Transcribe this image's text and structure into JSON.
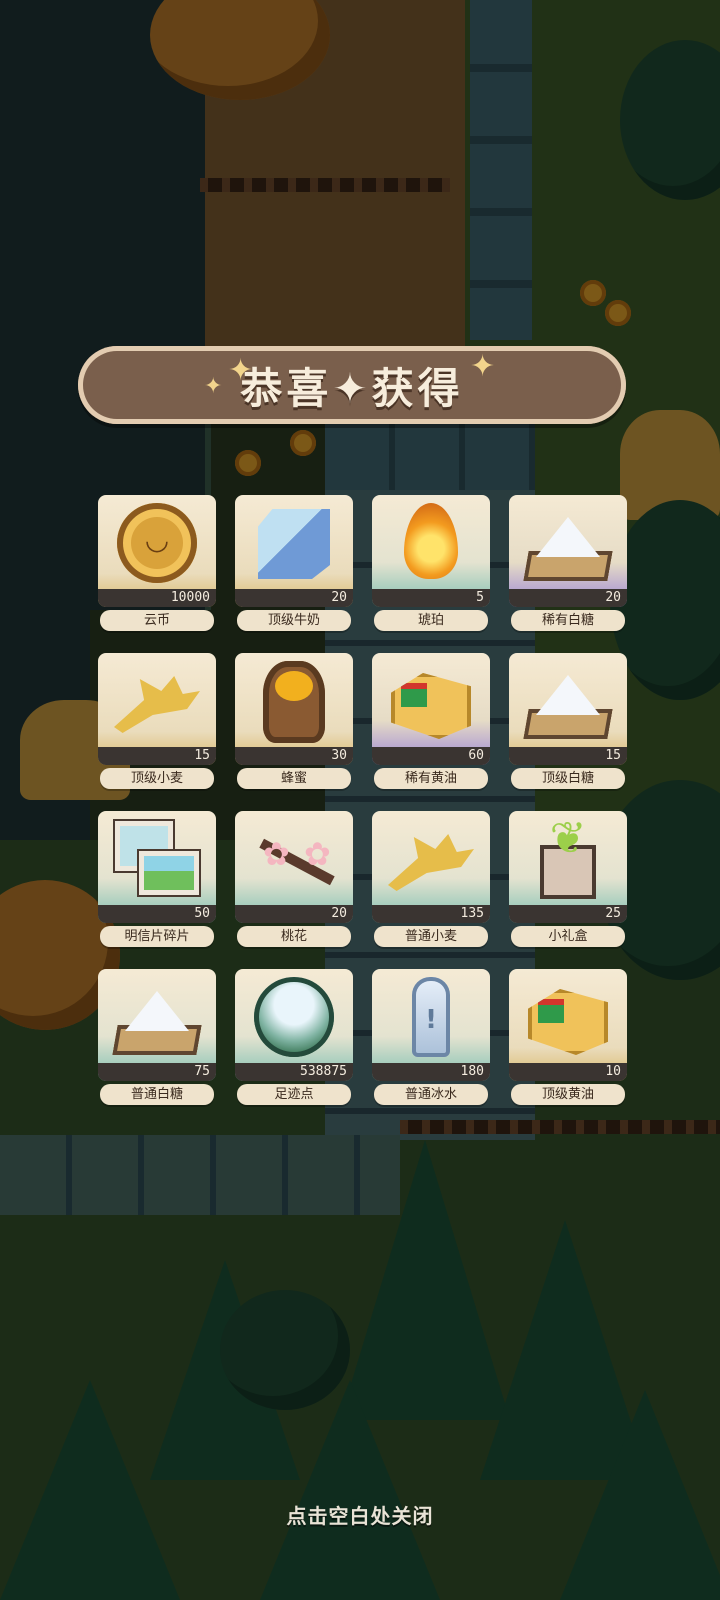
{
  "banner": {
    "title": "恭喜✦获得"
  },
  "rewards": [
    {
      "name": "云币",
      "qty": "10000",
      "icon": "coin-icon",
      "rarity": "gold"
    },
    {
      "name": "顶级牛奶",
      "qty": "20",
      "icon": "milk-carton-icon",
      "rarity": "gold"
    },
    {
      "name": "琥珀",
      "qty": "5",
      "icon": "amber-icon",
      "rarity": "teal"
    },
    {
      "name": "稀有白糖",
      "qty": "20",
      "icon": "sugar-icon",
      "rarity": "purple"
    },
    {
      "name": "顶级小麦",
      "qty": "15",
      "icon": "wheat-icon",
      "rarity": "gold"
    },
    {
      "name": "蜂蜜",
      "qty": "30",
      "icon": "honey-jar-icon",
      "rarity": "gold"
    },
    {
      "name": "稀有黄油",
      "qty": "60",
      "icon": "butter-icon",
      "rarity": "purple"
    },
    {
      "name": "顶级白糖",
      "qty": "15",
      "icon": "sugar-icon",
      "rarity": "gold"
    },
    {
      "name": "明信片碎片",
      "qty": "50",
      "icon": "postcard-icon",
      "rarity": "teal"
    },
    {
      "name": "桃花",
      "qty": "20",
      "icon": "peach-blossom-icon",
      "rarity": "teal"
    },
    {
      "name": "普通小麦",
      "qty": "135",
      "icon": "wheat-icon",
      "rarity": "teal"
    },
    {
      "name": "小礼盒",
      "qty": "25",
      "icon": "gift-box-icon",
      "rarity": "teal"
    },
    {
      "name": "普通白糖",
      "qty": "75",
      "icon": "sugar-icon",
      "rarity": "teal"
    },
    {
      "name": "足迹点",
      "qty": "538875",
      "icon": "orb-icon",
      "rarity": "teal"
    },
    {
      "name": "普通冰水",
      "qty": "180",
      "icon": "ice-water-icon",
      "rarity": "teal"
    },
    {
      "name": "顶级黄油",
      "qty": "10",
      "icon": "butter-icon",
      "rarity": "gold"
    }
  ],
  "close_hint": "点击空白处关闭"
}
